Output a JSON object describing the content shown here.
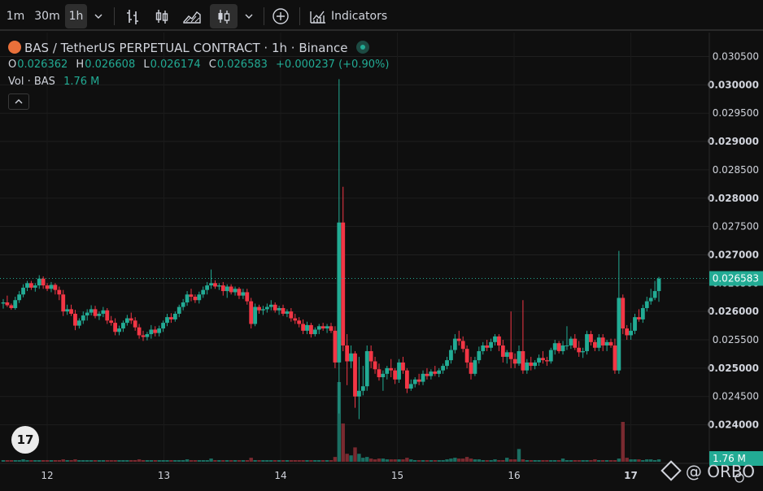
{
  "toolbar": {
    "intervals": [
      "1m",
      "30m",
      "1h"
    ],
    "active_interval": "1h",
    "indicators_label": "Indicators"
  },
  "legend": {
    "symbol_line": "BAS / TetherUS PERPETUAL CONTRACT · 1h · Binance",
    "o_label": "O",
    "o_value": "0.026362",
    "h_label": "H",
    "h_value": "0.026608",
    "l_label": "L",
    "l_value": "0.026174",
    "c_label": "C",
    "c_value": "0.026583",
    "change": "+0.000237 (+0.90%)",
    "vol_label": "Vol · BAS",
    "vol_value": "1.76 M"
  },
  "price_badge": "0.026583",
  "volume_badge": "1.76 M",
  "watermark_text": "@ ORBO",
  "colors": {
    "up": "#22ab94",
    "down": "#f23645",
    "up_vol": "#1b6e62",
    "down_vol": "#7a2a30"
  },
  "chart_data": {
    "type": "candlestick",
    "y_ticks": [
      "0.030500",
      "0.030000",
      "0.029500",
      "0.029000",
      "0.028500",
      "0.028000",
      "0.027500",
      "0.027000",
      "0.026500",
      "0.026000",
      "0.025500",
      "0.025000",
      "0.024500",
      "0.024000"
    ],
    "y_bold": [
      "0.030000",
      "0.029000",
      "0.028000",
      "0.027000",
      "0.026000",
      "0.025000",
      "0.024000"
    ],
    "ylim": [
      0.02375,
      0.03055
    ],
    "x_ticks": [
      "12",
      "13",
      "14",
      "15",
      "16",
      "17"
    ],
    "x_bold": [
      "17"
    ],
    "last_price": 0.026583,
    "candles": [
      [
        0.02614,
        0.02622,
        0.02605,
        0.02616
      ],
      [
        0.02616,
        0.02628,
        0.02608,
        0.02611
      ],
      [
        0.02611,
        0.02614,
        0.02603,
        0.02606
      ],
      [
        0.02606,
        0.02626,
        0.02603,
        0.0262
      ],
      [
        0.0262,
        0.02636,
        0.02615,
        0.0263
      ],
      [
        0.0263,
        0.02648,
        0.02625,
        0.02642
      ],
      [
        0.02642,
        0.02654,
        0.02636,
        0.0265
      ],
      [
        0.0265,
        0.02654,
        0.02638,
        0.02642
      ],
      [
        0.02642,
        0.0265,
        0.02635,
        0.02646
      ],
      [
        0.02646,
        0.02664,
        0.0264,
        0.02658
      ],
      [
        0.02658,
        0.02662,
        0.0264,
        0.02646
      ],
      [
        0.02646,
        0.0265,
        0.02636,
        0.0264
      ],
      [
        0.0264,
        0.02652,
        0.02634,
        0.02647
      ],
      [
        0.02647,
        0.0265,
        0.0263,
        0.02638
      ],
      [
        0.02638,
        0.02644,
        0.0262,
        0.0263
      ],
      [
        0.0263,
        0.02638,
        0.02592,
        0.026
      ],
      [
        0.026,
        0.02612,
        0.02594,
        0.02604
      ],
      [
        0.02604,
        0.02612,
        0.02592,
        0.02596
      ],
      [
        0.02596,
        0.02603,
        0.02567,
        0.02575
      ],
      [
        0.02575,
        0.02588,
        0.0257,
        0.02584
      ],
      [
        0.02584,
        0.026,
        0.02578,
        0.02593
      ],
      [
        0.02593,
        0.02604,
        0.02584,
        0.02598
      ],
      [
        0.02598,
        0.02611,
        0.02593,
        0.02604
      ],
      [
        0.02604,
        0.0261,
        0.02588,
        0.02592
      ],
      [
        0.02592,
        0.026,
        0.02585,
        0.02596
      ],
      [
        0.02596,
        0.02608,
        0.0259,
        0.02602
      ],
      [
        0.02602,
        0.02606,
        0.02578,
        0.02584
      ],
      [
        0.02584,
        0.02592,
        0.02575,
        0.0258
      ],
      [
        0.0258,
        0.02588,
        0.02558,
        0.02564
      ],
      [
        0.02564,
        0.02575,
        0.02558,
        0.0257
      ],
      [
        0.0257,
        0.02584,
        0.02564,
        0.0258
      ],
      [
        0.0258,
        0.02594,
        0.02575,
        0.02588
      ],
      [
        0.02588,
        0.02598,
        0.02578,
        0.02584
      ],
      [
        0.02584,
        0.0259,
        0.02566,
        0.02572
      ],
      [
        0.02572,
        0.02578,
        0.02552,
        0.02558
      ],
      [
        0.02558,
        0.02566,
        0.02548,
        0.02555
      ],
      [
        0.02555,
        0.02564,
        0.02549,
        0.0256
      ],
      [
        0.0256,
        0.02576,
        0.02552,
        0.02568
      ],
      [
        0.02568,
        0.02574,
        0.02556,
        0.02562
      ],
      [
        0.02562,
        0.02575,
        0.02556,
        0.0257
      ],
      [
        0.0257,
        0.02584,
        0.02564,
        0.0258
      ],
      [
        0.0258,
        0.02596,
        0.02574,
        0.0259
      ],
      [
        0.0259,
        0.02597,
        0.0258,
        0.02586
      ],
      [
        0.02586,
        0.026,
        0.02582,
        0.02596
      ],
      [
        0.02596,
        0.02612,
        0.0259,
        0.02608
      ],
      [
        0.02608,
        0.02622,
        0.02602,
        0.02616
      ],
      [
        0.02616,
        0.02636,
        0.0261,
        0.0263
      ],
      [
        0.0263,
        0.0264,
        0.02618,
        0.02626
      ],
      [
        0.02626,
        0.0263,
        0.02615,
        0.0262
      ],
      [
        0.0262,
        0.02635,
        0.02614,
        0.0263
      ],
      [
        0.0263,
        0.02644,
        0.02624,
        0.02638
      ],
      [
        0.02638,
        0.02652,
        0.0263,
        0.02646
      ],
      [
        0.02646,
        0.02674,
        0.0264,
        0.0265
      ],
      [
        0.0265,
        0.02655,
        0.0264,
        0.02644
      ],
      [
        0.02644,
        0.0265,
        0.02638,
        0.02646
      ],
      [
        0.02646,
        0.02652,
        0.02628,
        0.02636
      ],
      [
        0.02636,
        0.02648,
        0.02624,
        0.02644
      ],
      [
        0.02644,
        0.02648,
        0.0263,
        0.02634
      ],
      [
        0.02634,
        0.02644,
        0.02628,
        0.0264
      ],
      [
        0.0264,
        0.02643,
        0.02622,
        0.02628
      ],
      [
        0.02628,
        0.0264,
        0.02622,
        0.02634
      ],
      [
        0.02634,
        0.0264,
        0.02612,
        0.02618
      ],
      [
        0.02618,
        0.02624,
        0.0257,
        0.02578
      ],
      [
        0.02578,
        0.02614,
        0.02574,
        0.02608
      ],
      [
        0.02608,
        0.02612,
        0.02596,
        0.02602
      ],
      [
        0.02602,
        0.0261,
        0.02594,
        0.02604
      ],
      [
        0.02604,
        0.02614,
        0.02598,
        0.02608
      ],
      [
        0.02608,
        0.0262,
        0.02602,
        0.02612
      ],
      [
        0.02612,
        0.02616,
        0.02598,
        0.02602
      ],
      [
        0.02602,
        0.0261,
        0.02594,
        0.02606
      ],
      [
        0.02606,
        0.02612,
        0.02592,
        0.02596
      ],
      [
        0.02596,
        0.02604,
        0.0259,
        0.026
      ],
      [
        0.026,
        0.02606,
        0.02582,
        0.02588
      ],
      [
        0.02588,
        0.02596,
        0.02578,
        0.02584
      ],
      [
        0.02584,
        0.0259,
        0.02572,
        0.02578
      ],
      [
        0.02578,
        0.02586,
        0.0256,
        0.02566
      ],
      [
        0.02566,
        0.02582,
        0.0256,
        0.02576
      ],
      [
        0.02576,
        0.0258,
        0.02554,
        0.0256
      ],
      [
        0.0256,
        0.02572,
        0.02556,
        0.02568
      ],
      [
        0.02568,
        0.02578,
        0.0256,
        0.02574
      ],
      [
        0.02574,
        0.0258,
        0.02566,
        0.0257
      ],
      [
        0.0257,
        0.02578,
        0.02562,
        0.02574
      ],
      [
        0.02574,
        0.0258,
        0.02562,
        0.02566
      ],
      [
        0.02566,
        0.02574,
        0.025,
        0.0251
      ],
      [
        0.0251,
        0.0301,
        0.0242,
        0.02757
      ],
      [
        0.02757,
        0.0282,
        0.0253,
        0.0254
      ],
      [
        0.0254,
        0.0256,
        0.0247,
        0.02512
      ],
      [
        0.02512,
        0.0254,
        0.025,
        0.02526
      ],
      [
        0.02526,
        0.0253,
        0.0243,
        0.0245
      ],
      [
        0.0245,
        0.0252,
        0.0241,
        0.0246
      ],
      [
        0.0246,
        0.02504,
        0.02452,
        0.02468
      ],
      [
        0.02468,
        0.0254,
        0.0246,
        0.0253
      ],
      [
        0.0253,
        0.0254,
        0.025,
        0.02512
      ],
      [
        0.02512,
        0.0252,
        0.0249,
        0.02498
      ],
      [
        0.02498,
        0.02508,
        0.02478,
        0.02484
      ],
      [
        0.02484,
        0.02496,
        0.0246,
        0.0249
      ],
      [
        0.0249,
        0.02504,
        0.0248,
        0.025
      ],
      [
        0.025,
        0.02516,
        0.02484,
        0.02496
      ],
      [
        0.02496,
        0.025,
        0.02472,
        0.0248
      ],
      [
        0.0248,
        0.02516,
        0.02474,
        0.0251
      ],
      [
        0.0251,
        0.0252,
        0.0249,
        0.02496
      ],
      [
        0.02496,
        0.025,
        0.02456,
        0.02464
      ],
      [
        0.02464,
        0.0248,
        0.0246,
        0.02472
      ],
      [
        0.02472,
        0.02484,
        0.02466,
        0.0248
      ],
      [
        0.0248,
        0.0249,
        0.0247,
        0.02476
      ],
      [
        0.02476,
        0.02496,
        0.0247,
        0.0249
      ],
      [
        0.0249,
        0.025,
        0.0248,
        0.02486
      ],
      [
        0.02486,
        0.02498,
        0.0248,
        0.02494
      ],
      [
        0.02494,
        0.02504,
        0.02486,
        0.0249
      ],
      [
        0.0249,
        0.025,
        0.02484,
        0.02496
      ],
      [
        0.02496,
        0.02508,
        0.0249,
        0.02504
      ],
      [
        0.02504,
        0.0252,
        0.02498,
        0.02514
      ],
      [
        0.02514,
        0.0254,
        0.02508,
        0.02532
      ],
      [
        0.02532,
        0.0256,
        0.02526,
        0.02552
      ],
      [
        0.02552,
        0.02566,
        0.0254,
        0.02548
      ],
      [
        0.02548,
        0.02556,
        0.02528,
        0.02534
      ],
      [
        0.02534,
        0.0254,
        0.025,
        0.0251
      ],
      [
        0.0251,
        0.0252,
        0.0248,
        0.0249
      ],
      [
        0.0249,
        0.0252,
        0.02486,
        0.02514
      ],
      [
        0.02514,
        0.02538,
        0.02508,
        0.0253
      ],
      [
        0.0253,
        0.02546,
        0.02524,
        0.0254
      ],
      [
        0.0254,
        0.0255,
        0.0253,
        0.02536
      ],
      [
        0.02536,
        0.02552,
        0.0253,
        0.02546
      ],
      [
        0.02546,
        0.0256,
        0.0254,
        0.02556
      ],
      [
        0.02556,
        0.0256,
        0.0253,
        0.0254
      ],
      [
        0.0254,
        0.0255,
        0.0251,
        0.0252
      ],
      [
        0.0252,
        0.02532,
        0.02508,
        0.02528
      ],
      [
        0.02528,
        0.026,
        0.025,
        0.02516
      ],
      [
        0.02516,
        0.02526,
        0.025,
        0.02508
      ],
      [
        0.02508,
        0.0254,
        0.02504,
        0.0253
      ],
      [
        0.0253,
        0.0262,
        0.0249,
        0.02496
      ],
      [
        0.02496,
        0.02516,
        0.0249,
        0.0251
      ],
      [
        0.0251,
        0.0252,
        0.02496,
        0.02504
      ],
      [
        0.02504,
        0.02514,
        0.02498,
        0.0251
      ],
      [
        0.0251,
        0.02524,
        0.02504,
        0.02518
      ],
      [
        0.02518,
        0.0253,
        0.02508,
        0.02514
      ],
      [
        0.02514,
        0.0252,
        0.02504,
        0.02512
      ],
      [
        0.02512,
        0.02536,
        0.02508,
        0.02532
      ],
      [
        0.02532,
        0.0255,
        0.02524,
        0.02544
      ],
      [
        0.02544,
        0.02548,
        0.02526,
        0.0253
      ],
      [
        0.0253,
        0.02548,
        0.02524,
        0.0254
      ],
      [
        0.0254,
        0.02574,
        0.02532,
        0.0254
      ],
      [
        0.0254,
        0.02556,
        0.02534,
        0.02552
      ],
      [
        0.02552,
        0.0256,
        0.02532,
        0.02536
      ],
      [
        0.02536,
        0.02548,
        0.0252,
        0.02528
      ],
      [
        0.02528,
        0.02536,
        0.02518,
        0.0253
      ],
      [
        0.0253,
        0.02566,
        0.02524,
        0.0256
      ],
      [
        0.0256,
        0.02566,
        0.0254,
        0.02546
      ],
      [
        0.02546,
        0.0255,
        0.0253,
        0.02536
      ],
      [
        0.02536,
        0.0256,
        0.0253,
        0.02554
      ],
      [
        0.02554,
        0.0256,
        0.0253,
        0.0254
      ],
      [
        0.0254,
        0.0255,
        0.0253,
        0.02546
      ],
      [
        0.02546,
        0.02552,
        0.02536,
        0.0254
      ],
      [
        0.0254,
        0.02552,
        0.0249,
        0.02496
      ],
      [
        0.02496,
        0.02707,
        0.0249,
        0.02624
      ],
      [
        0.02624,
        0.0263,
        0.0256,
        0.0257
      ],
      [
        0.0257,
        0.02576,
        0.0255,
        0.02558
      ],
      [
        0.02558,
        0.0258,
        0.0255,
        0.02566
      ],
      [
        0.02566,
        0.02596,
        0.0256,
        0.0259
      ],
      [
        0.0259,
        0.02604,
        0.02582,
        0.02586
      ],
      [
        0.02586,
        0.02612,
        0.0258,
        0.02606
      ],
      [
        0.02606,
        0.02626,
        0.026,
        0.02618
      ],
      [
        0.02618,
        0.0264,
        0.02612,
        0.02624
      ],
      [
        0.02624,
        0.02654,
        0.0262,
        0.02636
      ],
      [
        0.02636,
        0.02661,
        0.02617,
        0.02658
      ]
    ],
    "volumes": [
      0.02,
      0.02,
      0.02,
      0.02,
      0.02,
      0.03,
      0.02,
      0.02,
      0.02,
      0.02,
      0.02,
      0.02,
      0.02,
      0.02,
      0.02,
      0.03,
      0.02,
      0.02,
      0.03,
      0.02,
      0.02,
      0.02,
      0.02,
      0.02,
      0.02,
      0.02,
      0.02,
      0.02,
      0.02,
      0.02,
      0.02,
      0.02,
      0.02,
      0.02,
      0.03,
      0.02,
      0.02,
      0.02,
      0.02,
      0.02,
      0.02,
      0.02,
      0.02,
      0.02,
      0.02,
      0.02,
      0.03,
      0.02,
      0.02,
      0.02,
      0.02,
      0.02,
      0.04,
      0.02,
      0.02,
      0.02,
      0.02,
      0.02,
      0.02,
      0.02,
      0.02,
      0.02,
      0.05,
      0.02,
      0.02,
      0.02,
      0.02,
      0.02,
      0.02,
      0.02,
      0.02,
      0.02,
      0.02,
      0.02,
      0.02,
      0.02,
      0.02,
      0.02,
      0.02,
      0.02,
      0.02,
      0.02,
      0.02,
      0.06,
      1.0,
      0.48,
      0.1,
      0.08,
      0.18,
      0.1,
      0.05,
      0.06,
      0.04,
      0.03,
      0.04,
      0.04,
      0.03,
      0.03,
      0.03,
      0.03,
      0.03,
      0.05,
      0.03,
      0.02,
      0.02,
      0.02,
      0.02,
      0.02,
      0.02,
      0.02,
      0.02,
      0.03,
      0.04,
      0.05,
      0.04,
      0.04,
      0.06,
      0.04,
      0.03,
      0.03,
      0.02,
      0.02,
      0.02,
      0.03,
      0.02,
      0.02,
      0.05,
      0.03,
      0.03,
      0.16,
      0.03,
      0.02,
      0.02,
      0.02,
      0.02,
      0.02,
      0.02,
      0.02,
      0.02,
      0.02,
      0.04,
      0.02,
      0.02,
      0.02,
      0.02,
      0.02,
      0.02,
      0.02,
      0.03,
      0.02,
      0.02,
      0.02,
      0.02,
      0.02,
      0.04,
      0.5,
      0.05,
      0.03,
      0.03,
      0.03,
      0.02,
      0.03,
      0.03,
      0.02,
      0.03,
      0.04
    ]
  }
}
